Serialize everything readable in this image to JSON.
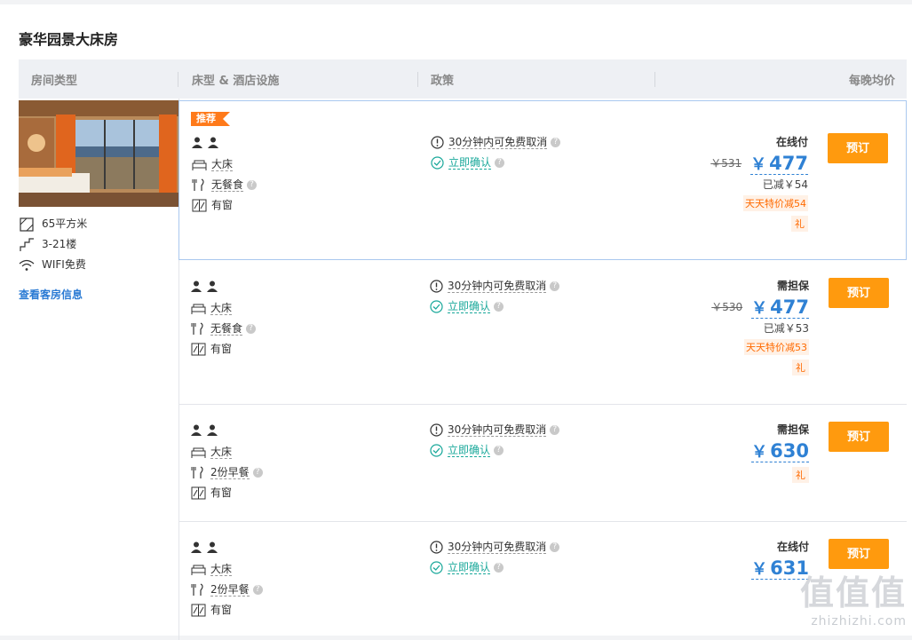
{
  "room": {
    "title": "豪华园景大床房",
    "headers": {
      "type": "房间类型",
      "bed": "床型 & 酒店设施",
      "policy": "政策",
      "price": "每晚均价"
    },
    "facilities": [
      {
        "icon": "area-icon",
        "text": "65平方米"
      },
      {
        "icon": "floor-icon",
        "text": "3-21楼"
      },
      {
        "icon": "wifi-icon",
        "text": "WIFI免费"
      }
    ],
    "view_link": "查看客房信息"
  },
  "rates": [
    {
      "badge": "推荐",
      "bed": "大床",
      "meal": "无餐食",
      "window": "有窗",
      "cancel": "30分钟内可免费取消",
      "confirm": "立即确认",
      "pay_type": "在线付",
      "original": "￥531",
      "currency": "￥",
      "price": "477",
      "reduced": "已减￥54",
      "promo": "天天特价减54",
      "gift": "礼",
      "book": "预订"
    },
    {
      "bed": "大床",
      "meal": "无餐食",
      "window": "有窗",
      "cancel": "30分钟内可免费取消",
      "confirm": "立即确认",
      "pay_type": "需担保",
      "original": "￥530",
      "currency": "￥",
      "price": "477",
      "reduced": "已减￥53",
      "promo": "天天特价减53",
      "gift": "礼",
      "book": "预订"
    },
    {
      "bed": "大床",
      "meal": "2份早餐",
      "window": "有窗",
      "cancel": "30分钟内可免费取消",
      "confirm": "立即确认",
      "pay_type": "需担保",
      "currency": "￥",
      "price": "630",
      "gift": "礼",
      "book": "预订"
    },
    {
      "bed": "大床",
      "meal": "2份早餐",
      "window": "有窗",
      "cancel": "30分钟内可免费取消",
      "confirm": "立即确认",
      "pay_type": "在线付",
      "currency": "￥",
      "price": "631",
      "book": "预订"
    }
  ],
  "watermark": {
    "logo": "值值值",
    "url": "zhizhizhi.com"
  },
  "colors": {
    "accent_blue": "#2f81d4",
    "book_orange": "#ff9a0e",
    "badge_orange": "#ff7a1a",
    "confirm_teal": "#19a89a",
    "promo_orange": "#ff6a00"
  }
}
